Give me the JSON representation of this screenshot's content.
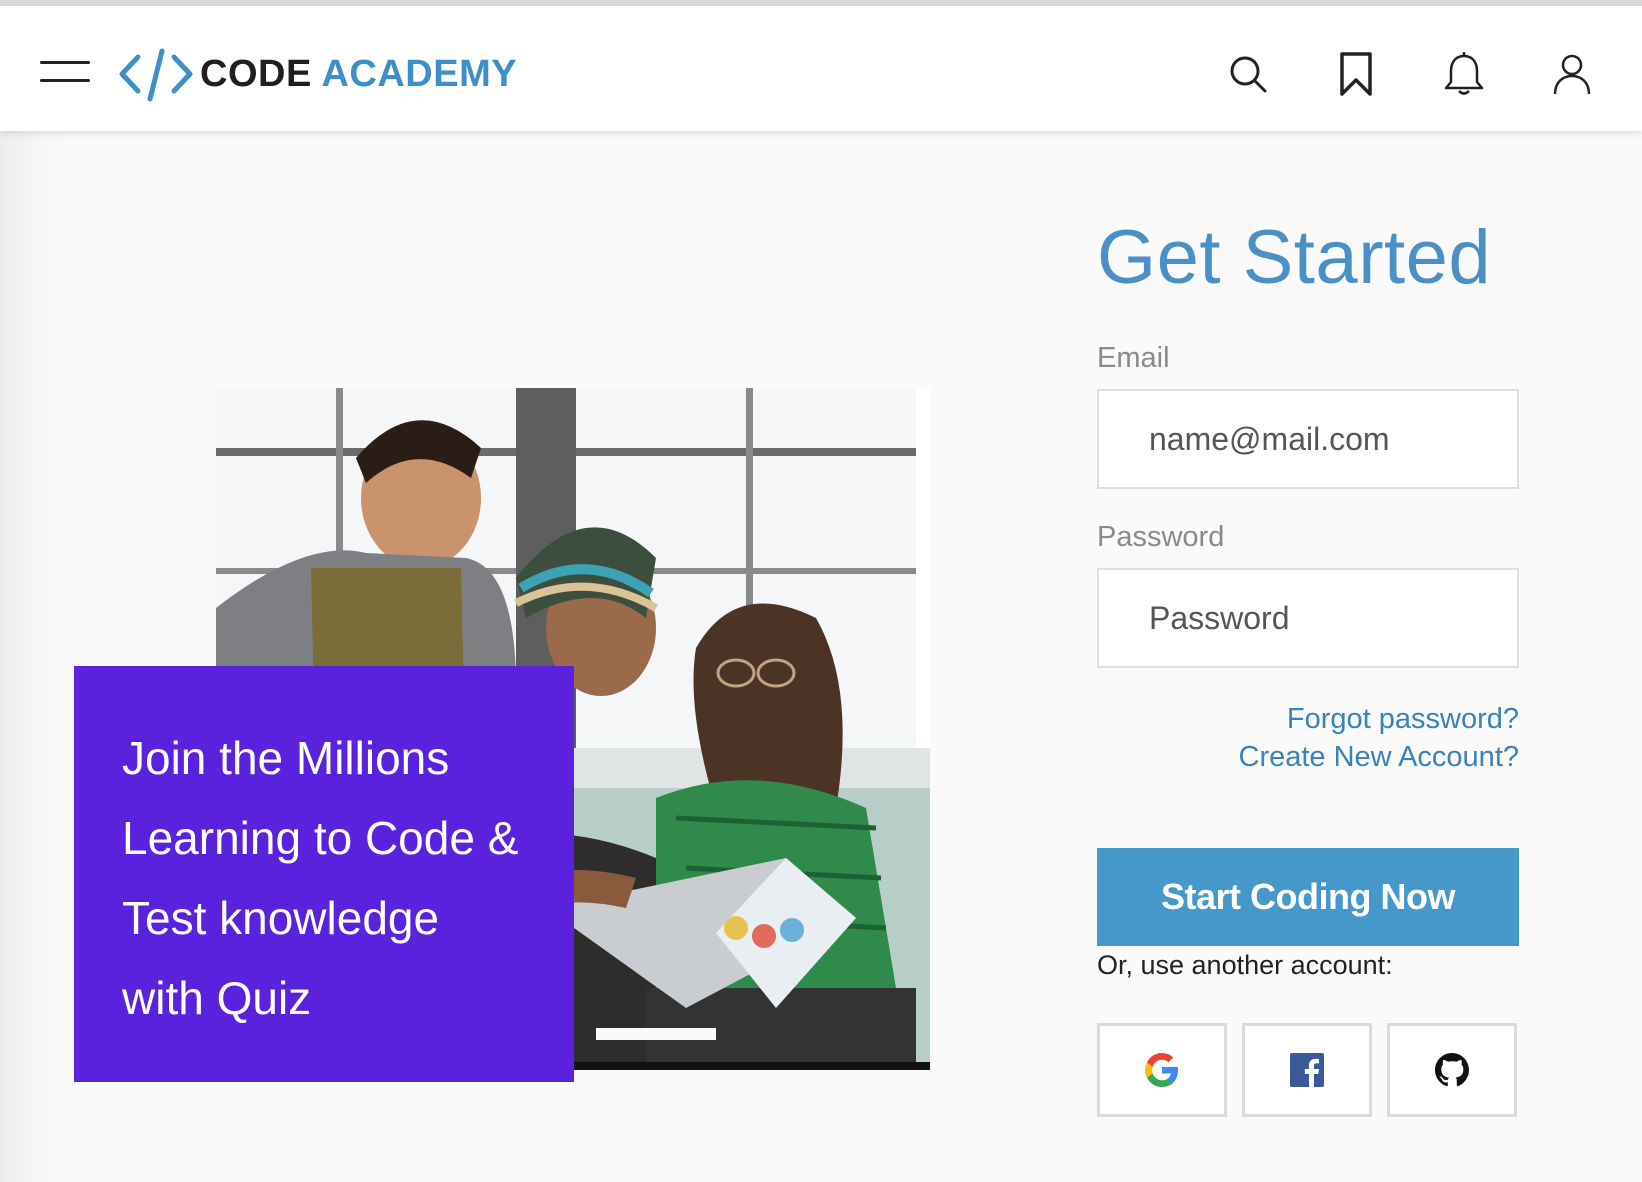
{
  "header": {
    "logo_code": "CODE",
    "logo_academy": "ACADEMY",
    "icons": [
      "menu-icon",
      "search-icon",
      "bookmark-icon",
      "bell-icon",
      "user-icon"
    ]
  },
  "promo": {
    "lines": [
      "Join the Millions",
      "Learning to Code &",
      "Test knowledge",
      "with Quiz"
    ]
  },
  "form": {
    "title": "Get Started",
    "email_label": "Email",
    "email_placeholder": "name@mail.com",
    "password_label": "Password",
    "password_placeholder": "Password",
    "forgot_link": "Forgot password?",
    "create_link": "Create New Account?",
    "submit_label": "Start Coding Now",
    "alt_text": "Or, use another account:",
    "social_icons": [
      "google-icon",
      "facebook-icon",
      "github-icon"
    ]
  },
  "colors": {
    "accent": "#4598c9",
    "title": "#4a8fc6",
    "promo_bg": "#5a22dc",
    "link": "#3a82b8"
  }
}
